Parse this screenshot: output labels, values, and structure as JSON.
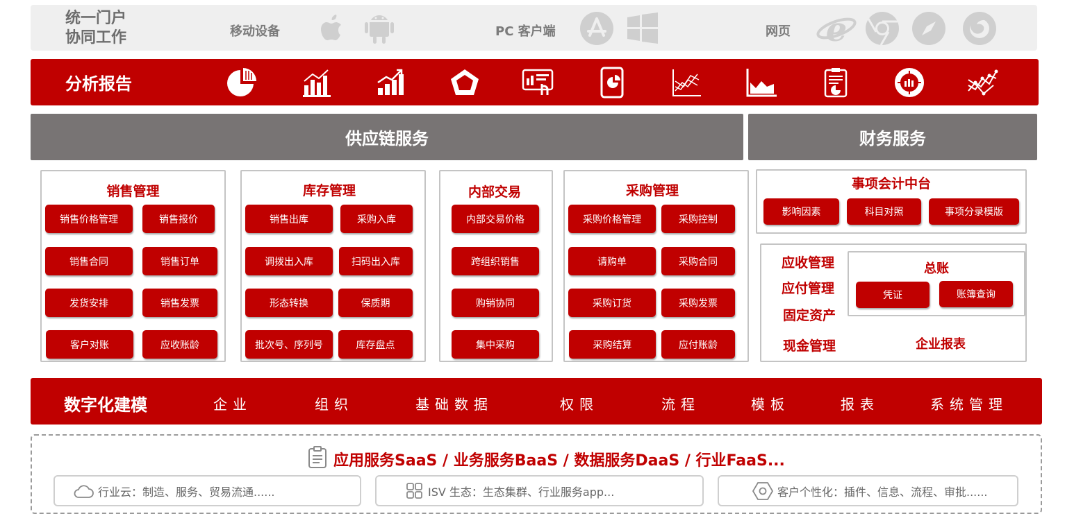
{
  "portal": {
    "title_line1": "统一门户",
    "title_line2": "协同工作",
    "mobile_label": "移动设备",
    "pc_label": "PC 客户端",
    "web_label": "网页",
    "icons": [
      "apple-icon",
      "android-icon",
      "app-store-icon",
      "windows-icon",
      "ie-icon",
      "chrome-icon",
      "safari-icon",
      "firefox-icon"
    ]
  },
  "analysis": {
    "title": "分析报告",
    "icons": [
      "pie-chart-icon",
      "bar-chart-icon",
      "growth-chart-icon",
      "radar-chart-icon",
      "dashboard-screen-icon",
      "tablet-report-icon",
      "line-chart-icon",
      "area-chart-icon",
      "clipboard-report-icon",
      "donut-chart-icon",
      "trend-chart-icon"
    ]
  },
  "supply_chain": {
    "title": "供应链服务"
  },
  "finance": {
    "title": "财务服务"
  },
  "sales": {
    "title": "销售管理",
    "items": [
      "销售价格管理",
      "销售报价",
      "销售合同",
      "销售订单",
      "发货安排",
      "销售发票",
      "客户对账",
      "应收账龄"
    ]
  },
  "inventory": {
    "title": "库存管理",
    "items": [
      "销售出库",
      "采购入库",
      "调拨出入库",
      "扫码出入库",
      "形态转换",
      "保质期",
      "批次号、序列号",
      "库存盘点"
    ]
  },
  "internal": {
    "title": "内部交易",
    "items": [
      "内部交易价格",
      "跨组织销售",
      "购销协同",
      "集中采购"
    ]
  },
  "purchase": {
    "title": "采购管理",
    "items": [
      "采购价格管理",
      "采购控制",
      "请购单",
      "采购合同",
      "采购订货",
      "采购发票",
      "采购结算",
      "应付账龄"
    ]
  },
  "accounting_center": {
    "title": "事项会计中台",
    "items": [
      "影响因素",
      "科目对照",
      "事项分录模版"
    ]
  },
  "ledger_area": {
    "receivable": "应收管理",
    "payable": "应付管理",
    "fixed_assets": "固定资产",
    "cash": "现金管理",
    "ledger_title": "总账",
    "voucher": "凭证",
    "book_query": "账簿查询",
    "reports": "企业报表"
  },
  "modeling": {
    "title": "数字化建模",
    "items": [
      "企业",
      "组织",
      "基础数据",
      "权限",
      "流程",
      "模板",
      "报表",
      "系统管理"
    ]
  },
  "platform": {
    "title": "应用服务SaaS / 业务服务BaaS / 数据服务DaaS / 行业FaaS...",
    "industry_cloud": "行业云：制造、服务、贸易流通......",
    "isv": "ISV 生态：生态集群、行业服务app...",
    "customization": "客户个性化：插件、信息、流程、审批......"
  },
  "colors": {
    "brand_red": "#c00000",
    "header_gray": "#787474",
    "portal_bg": "#efefef"
  }
}
